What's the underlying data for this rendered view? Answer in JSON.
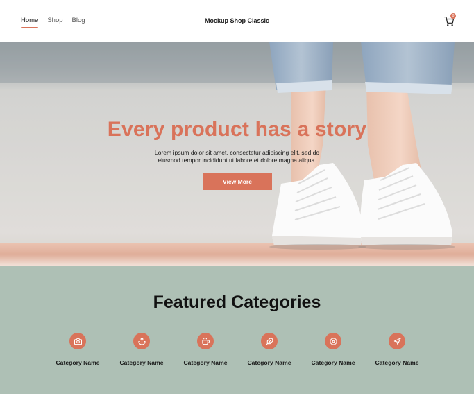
{
  "header": {
    "nav": [
      {
        "label": "Home"
      },
      {
        "label": "Shop"
      },
      {
        "label": "Blog"
      }
    ],
    "brand": "Mockup Shop Classic",
    "cart_count": "0"
  },
  "hero": {
    "title": "Every product has a story",
    "subtitle": "Lorem ipsum dolor sit amet, consectetur adipiscing elit, sed do eiusmod tempor incididunt ut labore et dolore magna aliqua.",
    "button": "View More"
  },
  "categories": {
    "title": "Featured Categories",
    "items": [
      {
        "label": "Category Name",
        "icon": "camera-icon"
      },
      {
        "label": "Category Name",
        "icon": "anchor-icon"
      },
      {
        "label": "Category Name",
        "icon": "coffee-icon"
      },
      {
        "label": "Category Name",
        "icon": "feather-icon"
      },
      {
        "label": "Category Name",
        "icon": "compass-icon"
      },
      {
        "label": "Category Name",
        "icon": "send-icon"
      }
    ]
  },
  "colors": {
    "accent": "#d9735a",
    "categories_bg": "#aec0b5"
  }
}
